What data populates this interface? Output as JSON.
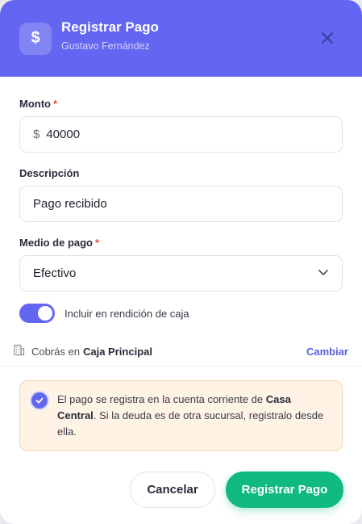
{
  "header": {
    "icon": "dollar-icon",
    "icon_glyph": "$",
    "title": "Registrar Pago",
    "subtitle": "Gustavo Fernández"
  },
  "form": {
    "amount": {
      "label": "Monto",
      "required": "*",
      "currency": "$",
      "value": "40000"
    },
    "description": {
      "label": "Descripción",
      "value": "Pago recibido"
    },
    "payment_method": {
      "label": "Medio de pago",
      "required": "*",
      "selected": "Efectivo"
    },
    "include_cash": {
      "label": "Incluir en rendición de caja",
      "checked": true
    }
  },
  "cash_box": {
    "prefix": "Cobrás en",
    "name": "Caja Principal",
    "change_label": "Cambiar"
  },
  "notice": {
    "text_before": "El pago se registra en la cuenta corriente de ",
    "branch": "Casa Central",
    "text_after": ". Si la deuda es de otra sucursal, registralo desde ella."
  },
  "buttons": {
    "cancel": "Cancelar",
    "submit": "Registrar Pago"
  },
  "colors": {
    "accent": "#6366f1",
    "success": "#10b981",
    "required": "#e5484d",
    "notice_bg": "#fff3e6"
  }
}
